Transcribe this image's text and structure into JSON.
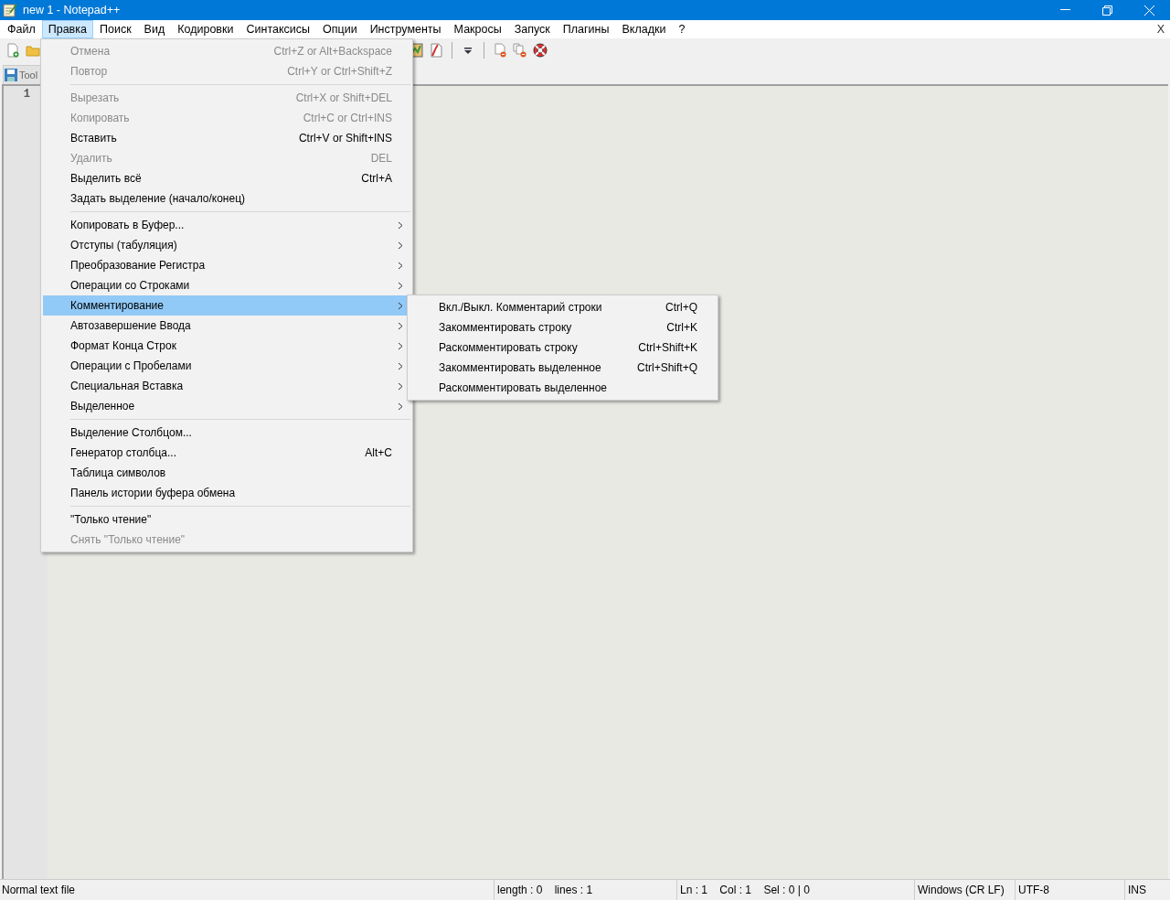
{
  "window": {
    "title": "new 1 - Notepad++"
  },
  "menu_bar": [
    {
      "label": "Файл",
      "selected": false
    },
    {
      "label": "Правка",
      "selected": true
    },
    {
      "label": "Поиск",
      "selected": false
    },
    {
      "label": "Вид",
      "selected": false
    },
    {
      "label": "Кодировки",
      "selected": false
    },
    {
      "label": "Синтаксисы",
      "selected": false
    },
    {
      "label": "Опции",
      "selected": false
    },
    {
      "label": "Инструменты",
      "selected": false
    },
    {
      "label": "Макросы",
      "selected": false
    },
    {
      "label": "Запуск",
      "selected": false
    },
    {
      "label": "Плагины",
      "selected": false
    },
    {
      "label": "Вкладки",
      "selected": false
    },
    {
      "label": "?",
      "selected": false
    }
  ],
  "close_document": "X",
  "tab": {
    "label": "Tool"
  },
  "editor": {
    "line_numbers": [
      "1"
    ]
  },
  "edit_menu": [
    {
      "kind": "item",
      "label": "Отмена",
      "shortcut": "Ctrl+Z or Alt+Backspace",
      "disabled": true,
      "submenu": false,
      "selected": false
    },
    {
      "kind": "item",
      "label": "Повтор",
      "shortcut": "Ctrl+Y or Ctrl+Shift+Z",
      "disabled": true,
      "submenu": false,
      "selected": false
    },
    {
      "kind": "separator"
    },
    {
      "kind": "item",
      "label": "Вырезать",
      "shortcut": "Ctrl+X or Shift+DEL",
      "disabled": true,
      "submenu": false,
      "selected": false
    },
    {
      "kind": "item",
      "label": "Копировать",
      "shortcut": "Ctrl+C or Ctrl+INS",
      "disabled": true,
      "submenu": false,
      "selected": false
    },
    {
      "kind": "item",
      "label": "Вставить",
      "shortcut": "Ctrl+V or Shift+INS",
      "disabled": false,
      "submenu": false,
      "selected": false
    },
    {
      "kind": "item",
      "label": "Удалить",
      "shortcut": "DEL",
      "disabled": true,
      "submenu": false,
      "selected": false
    },
    {
      "kind": "item",
      "label": "Выделить всё",
      "shortcut": "Ctrl+A",
      "disabled": false,
      "submenu": false,
      "selected": false
    },
    {
      "kind": "item",
      "label": "Задать выделение (начало/конец)",
      "disabled": false,
      "submenu": false,
      "selected": false
    },
    {
      "kind": "separator"
    },
    {
      "kind": "item",
      "label": "Копировать в Буфер...",
      "disabled": false,
      "submenu": true,
      "selected": false
    },
    {
      "kind": "item",
      "label": "Отступы (табуляция)",
      "disabled": false,
      "submenu": true,
      "selected": false
    },
    {
      "kind": "item",
      "label": "Преобразование Регистра",
      "disabled": false,
      "submenu": true,
      "selected": false
    },
    {
      "kind": "item",
      "label": "Операции со Строками",
      "disabled": false,
      "submenu": true,
      "selected": false
    },
    {
      "kind": "item",
      "label": "Комментирование",
      "disabled": false,
      "submenu": true,
      "selected": true
    },
    {
      "kind": "item",
      "label": "Автозавершение Ввода",
      "disabled": false,
      "submenu": true,
      "selected": false
    },
    {
      "kind": "item",
      "label": "Формат Конца Строк",
      "disabled": false,
      "submenu": true,
      "selected": false
    },
    {
      "kind": "item",
      "label": "Операции с Пробелами",
      "disabled": false,
      "submenu": true,
      "selected": false
    },
    {
      "kind": "item",
      "label": "Специальная Вставка",
      "disabled": false,
      "submenu": true,
      "selected": false
    },
    {
      "kind": "item",
      "label": "Выделенное",
      "disabled": false,
      "submenu": true,
      "selected": false
    },
    {
      "kind": "separator"
    },
    {
      "kind": "item",
      "label": "Выделение Столбцом...",
      "disabled": false,
      "submenu": false,
      "selected": false
    },
    {
      "kind": "item",
      "label": "Генератор столбца...",
      "shortcut": "Alt+C",
      "disabled": false,
      "submenu": false,
      "selected": false
    },
    {
      "kind": "item",
      "label": "Таблица символов",
      "disabled": false,
      "submenu": false,
      "selected": false
    },
    {
      "kind": "item",
      "label": "Панель истории буфера обмена",
      "disabled": false,
      "submenu": false,
      "selected": false
    },
    {
      "kind": "separator"
    },
    {
      "kind": "item",
      "label": "\"Только чтение\"",
      "disabled": false,
      "submenu": false,
      "selected": false
    },
    {
      "kind": "item",
      "label": "Снять \"Только чтение\"",
      "disabled": true,
      "submenu": false,
      "selected": false
    }
  ],
  "comment_submenu": [
    {
      "label": "Вкл./Выкл. Комментарий строки",
      "shortcut": "Ctrl+Q"
    },
    {
      "label": "Закомментировать строку",
      "shortcut": "Ctrl+K"
    },
    {
      "label": "Раскомментировать строку",
      "shortcut": "Ctrl+Shift+K"
    },
    {
      "label": "Закомментировать выделенное",
      "shortcut": "Ctrl+Shift+Q"
    },
    {
      "label": "Раскомментировать выделенное"
    }
  ],
  "status_bar": [
    "Normal text file",
    "length : 0    lines : 1",
    "Ln : 1    Col : 1    Sel : 0 | 0",
    "Windows (CR LF)",
    "UTF-8",
    "INS"
  ]
}
